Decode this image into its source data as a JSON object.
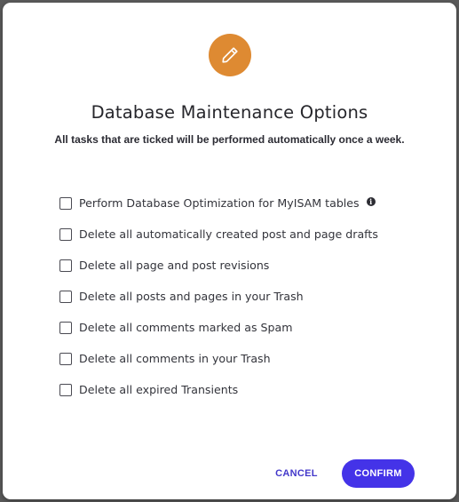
{
  "modal": {
    "icon": "pencil-icon",
    "accent_color": "#de8a32",
    "title": "Database Maintenance Options",
    "subtitle": "All tasks that are ticked will be performed automatically once a week."
  },
  "options": [
    {
      "label": "Perform Database Optimization for MyISAM tables",
      "checked": false,
      "info_icon": "info-icon"
    },
    {
      "label": "Delete all automatically created post and page drafts",
      "checked": false
    },
    {
      "label": "Delete all page and post revisions",
      "checked": false
    },
    {
      "label": "Delete all posts and pages in your Trash",
      "checked": false
    },
    {
      "label": "Delete all comments marked as Spam",
      "checked": false
    },
    {
      "label": "Delete all comments in your Trash",
      "checked": false
    },
    {
      "label": "Delete all expired Transients",
      "checked": false
    }
  ],
  "actions": {
    "cancel_label": "CANCEL",
    "confirm_label": "CONFIRM",
    "confirm_color": "#4433e8"
  }
}
